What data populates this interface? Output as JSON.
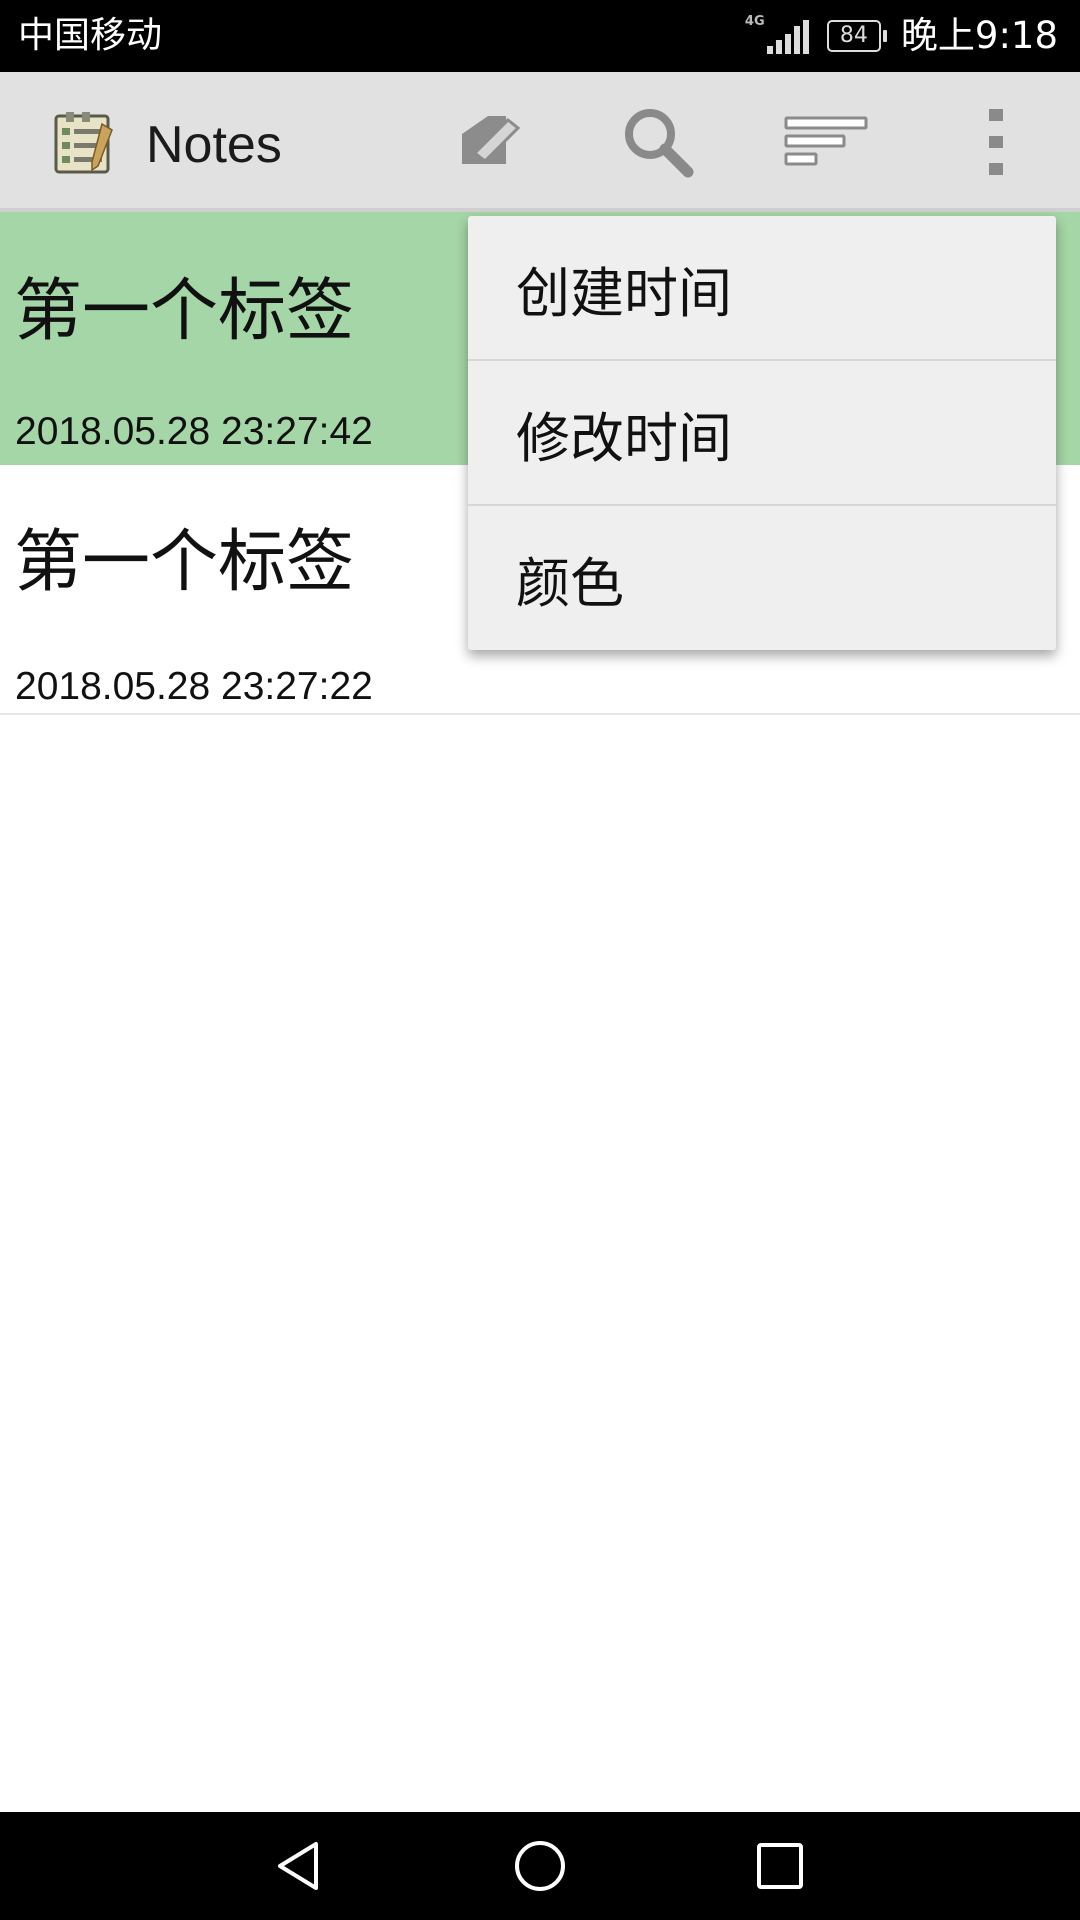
{
  "status_bar": {
    "carrier": "中国移动",
    "network": "4G",
    "battery": "84",
    "time": "晚上9:18"
  },
  "action_bar": {
    "title": "Notes",
    "icons": [
      "app-notes-icon",
      "edit-icon",
      "search-icon",
      "sort-icon",
      "overflow-menu-icon"
    ]
  },
  "notes": [
    {
      "title": "第一个标签",
      "time": "2018.05.28 23:27:42",
      "color": "#a5d6a7"
    },
    {
      "title": "第一个标签",
      "time": "2018.05.28 23:27:22",
      "color": "#ffffff"
    }
  ],
  "sort_menu": {
    "items": [
      "创建时间",
      "修改时间",
      "颜色"
    ]
  },
  "nav_bar": {
    "icons": [
      "back-icon",
      "home-icon",
      "recents-icon"
    ]
  }
}
